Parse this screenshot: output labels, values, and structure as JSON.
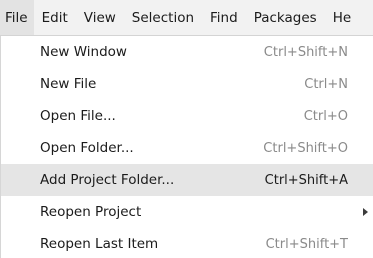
{
  "menubar": {
    "items": [
      {
        "label": "File"
      },
      {
        "label": "Edit"
      },
      {
        "label": "View"
      },
      {
        "label": "Selection"
      },
      {
        "label": "Find"
      },
      {
        "label": "Packages"
      },
      {
        "label": "He"
      }
    ]
  },
  "file_menu": {
    "items": [
      {
        "label": "New Window",
        "shortcut": "Ctrl+Shift+N"
      },
      {
        "label": "New File",
        "shortcut": "Ctrl+N"
      },
      {
        "label": "Open File...",
        "shortcut": "Ctrl+O"
      },
      {
        "label": "Open Folder...",
        "shortcut": "Ctrl+Shift+O"
      },
      {
        "label": "Add Project Folder...",
        "shortcut": "Ctrl+Shift+A"
      },
      {
        "label": "Reopen Project",
        "submenu_icon": "chevron-right-icon"
      },
      {
        "label": "Reopen Last Item",
        "shortcut": "Ctrl+Shift+T"
      }
    ],
    "highlighted_item": "Add Project Folder..."
  }
}
